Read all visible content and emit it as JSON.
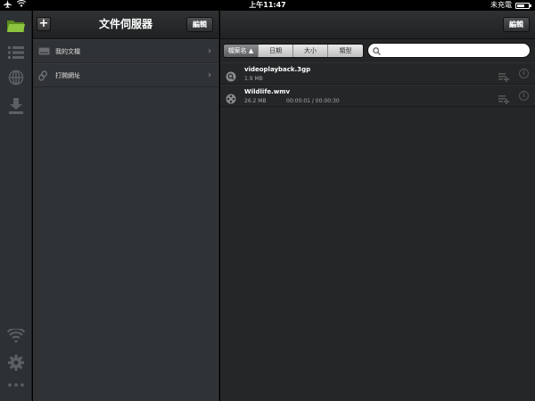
{
  "status_bar": {
    "time": "上午11:47",
    "carrier_status": "未充電"
  },
  "file_panel": {
    "title": "文件伺服器",
    "add_label": "+",
    "edit_label": "編輯",
    "items": [
      {
        "label": "我的文檔",
        "icon": "drive-icon"
      },
      {
        "label": "打開網址",
        "icon": "link-icon"
      }
    ]
  },
  "main": {
    "edit_label": "編輯",
    "sort_options": [
      {
        "label": "檔案名 ▲",
        "active": true
      },
      {
        "label": "日期",
        "active": false
      },
      {
        "label": "大小",
        "active": false
      },
      {
        "label": "類型",
        "active": false
      }
    ],
    "search": {
      "placeholder": "",
      "value": ""
    },
    "files": [
      {
        "name": "videoplayback.3gp",
        "size": "1.9 MB",
        "duration": "",
        "icon": "video-search-icon"
      },
      {
        "name": "Wildlife.wmv",
        "size": "26.2 MB",
        "duration": "00:00:01 / 00:00:30",
        "icon": "film-reel-icon"
      }
    ]
  },
  "colors": {
    "folder_accent": "#8cc63f",
    "background": "#242627"
  }
}
